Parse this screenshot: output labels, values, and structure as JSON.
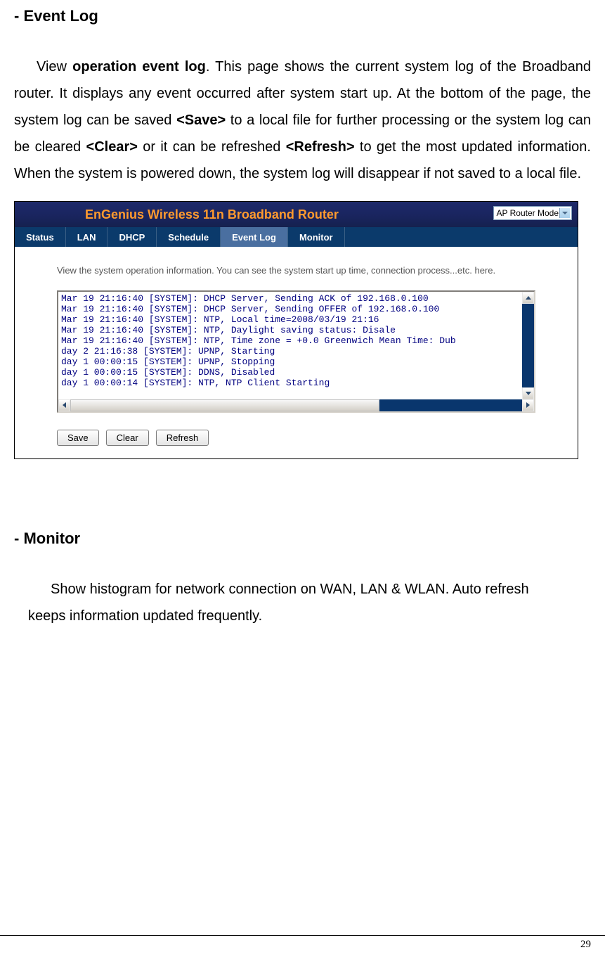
{
  "heading1": "- Event Log",
  "para1": {
    "p1a": "View ",
    "p1b": "operation event log",
    "p1c": ". This page shows the current system log of the Broadband router. It displays any event occurred after system start up. At the bottom of the page, the system log can be saved ",
    "p1d": "<Save>",
    "p1e": " to a local file for further processing or the system log can be cleared ",
    "p1f": "<Clear>",
    "p1g": " or it can be refreshed ",
    "p1h": "<Refresh>",
    "p1i": " to get the most updated information. When the system is powered down, the system log will disappear if not saved to a local file."
  },
  "banner_title": "EnGenius Wireless 11n Broadband Router",
  "mode_dropdown": "AP Router Mode",
  "nav": {
    "status": "Status",
    "lan": "LAN",
    "dhcp": "DHCP",
    "schedule": "Schedule",
    "eventlog": "Event Log",
    "monitor": "Monitor"
  },
  "admin_desc": "View the system operation information. You can see the system start up time, connection process...etc. here.",
  "log_lines": {
    "l0": "Mar 19 21:16:40 [SYSTEM]: DHCP Server, Sending ACK of 192.168.0.100",
    "l1": "Mar 19 21:16:40 [SYSTEM]: DHCP Server, Sending OFFER of 192.168.0.100",
    "l2": "Mar 19 21:16:40 [SYSTEM]: NTP, Local time=2008/03/19 21:16",
    "l3": "Mar 19 21:16:40 [SYSTEM]: NTP, Daylight saving status: Disale",
    "l4": "Mar 19 21:16:40 [SYSTEM]: NTP, Time zone = +0.0 Greenwich Mean Time: Dub",
    "l5": "day  2 21:16:38 [SYSTEM]: UPNP, Starting",
    "l6": "day  1 00:00:15 [SYSTEM]: UPNP, Stopping",
    "l7": "day  1 00:00:15 [SYSTEM]: DDNS, Disabled",
    "l8": "day  1 00:00:14 [SYSTEM]: NTP, NTP Client Starting"
  },
  "buttons": {
    "save": "Save",
    "clear": "Clear",
    "refresh": "Refresh"
  },
  "heading2": "- Monitor",
  "para2": {
    "line1": "Show histogram for network connection on WAN, LAN & WLAN. Auto refresh",
    "line2": "keeps information updated frequently."
  },
  "page_number": "29"
}
